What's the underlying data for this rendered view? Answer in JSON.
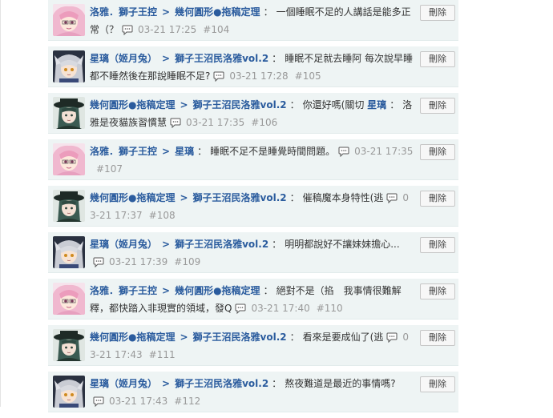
{
  "actions": {
    "delete_label": "刪除"
  },
  "comments": [
    {
      "avatar": "pink-haired-character",
      "author": "洛雅．獅子王控",
      "target": "幾何圓形●拖稿定理",
      "text": "一個睡眠不足的人講話是能多正常（？",
      "time": "03-21 17:25",
      "post": "#104"
    },
    {
      "avatar": "silver-haired-character",
      "author": "星璃（姬月兔）",
      "target": "獅子王沼民洛雅vol.2",
      "text": "睡眠不足就去睡阿 每次說早睡都不睡然後在那說睡眠不足?",
      "time": "03-21 17:28",
      "post": "#105"
    },
    {
      "avatar": "dark-hat-character",
      "author": "幾何圓形●拖稿定理",
      "target": "獅子王沼民洛雅vol.2",
      "text": "你還好嗎(關切",
      "mention": "星璃",
      "text2": "洛雅是夜貓族習慣慧",
      "time": "03-21 17:35",
      "post": "#106"
    },
    {
      "avatar": "pink-haired-character",
      "author": "洛雅．獅子王控",
      "target": "星璃",
      "text": "睡眠不足不是睡覺時間問題。",
      "time": "03-21 17:35",
      "post": "#107"
    },
    {
      "avatar": "dark-hat-character",
      "author": "幾何圓形●拖稿定理",
      "target": "獅子王沼民洛雅vol.2",
      "text": "催稿魔本身特性(逃",
      "time": "03-21 17:37",
      "post": "#108"
    },
    {
      "avatar": "silver-haired-character",
      "author": "星璃（姬月兔）",
      "target": "獅子王沼民洛雅vol.2",
      "text": "明明都說好不讓妹妹擔心...",
      "time": "03-21 17:39",
      "post": "#109"
    },
    {
      "avatar": "pink-haired-character",
      "author": "洛雅．獅子王控",
      "target": "幾何圓形●拖稿定理",
      "text": "絕對不是（掐　我事情很難解釋，都快踏入非現實的領域，發Q",
      "time": "03-21 17:40",
      "post": "#110"
    },
    {
      "avatar": "dark-hat-character",
      "author": "幾何圓形●拖稿定理",
      "target": "獅子王沼民洛雅vol.2",
      "text": "看來是要成仙了(逃",
      "time": "03-21 17:43",
      "post": "#111"
    },
    {
      "avatar": "silver-haired-character",
      "author": "星璃（姬月兔）",
      "target": "獅子王沼民洛雅vol.2",
      "text": "熬夜難道是最近的事情嗎?",
      "time": "03-21 17:43",
      "post": "#112"
    }
  ]
}
